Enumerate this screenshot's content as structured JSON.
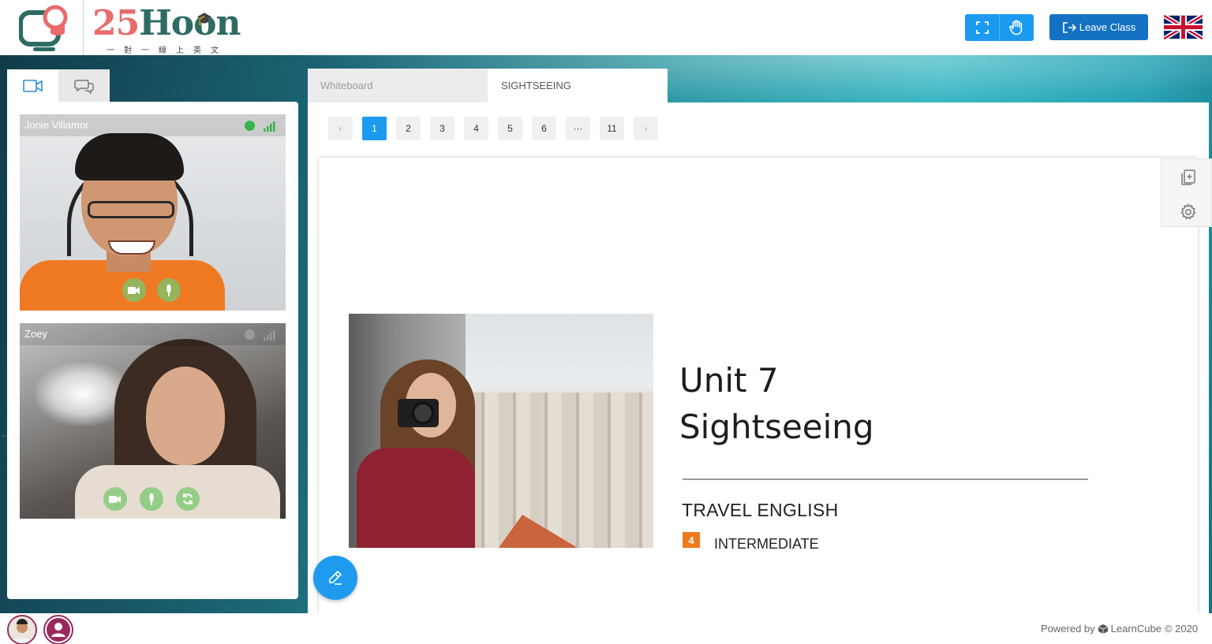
{
  "brand": {
    "number": "25",
    "word": "Hoon",
    "subtitle": "一對一線上英文"
  },
  "header": {
    "fullscreen_icon": "fullscreen-icon",
    "raise_hand_icon": "hand-icon",
    "leave_label": "Leave Class",
    "language_flag": "uk-flag"
  },
  "left_panel": {
    "tabs": [
      {
        "name": "video",
        "icon": "video-camera-icon"
      },
      {
        "name": "chat",
        "icon": "chat-bubbles-icon"
      }
    ],
    "videos": [
      {
        "name": "Jonie Villamor",
        "status_color": "#37b34a"
      },
      {
        "name": "Zoey",
        "status_color": "#9a9a9a"
      }
    ]
  },
  "tabs": [
    {
      "label": "Whiteboard"
    },
    {
      "label": "SIGHTSEEING"
    }
  ],
  "pager": {
    "prev": "‹",
    "pages": [
      "1",
      "2",
      "3",
      "4",
      "5",
      "6",
      "···",
      "11"
    ],
    "next": "›",
    "current": "1"
  },
  "slide": {
    "unit": "Unit 7",
    "title": "Sightseeing",
    "course": "TRAVEL ENGLISH",
    "level_number": "4",
    "level_name": "INTERMEDIATE"
  },
  "side_tools": [
    "add-page-icon",
    "settings-icon"
  ],
  "footer": {
    "powered_prefix": "Powered by",
    "brand": "LearnCube",
    "copyright": "© 2020"
  },
  "colors": {
    "primary_blue": "#1b9af0",
    "leave_blue": "#1471c4",
    "orange_badge": "#ef7a1e",
    "logo_red": "#e96b6b",
    "logo_green": "#2e6b63"
  }
}
